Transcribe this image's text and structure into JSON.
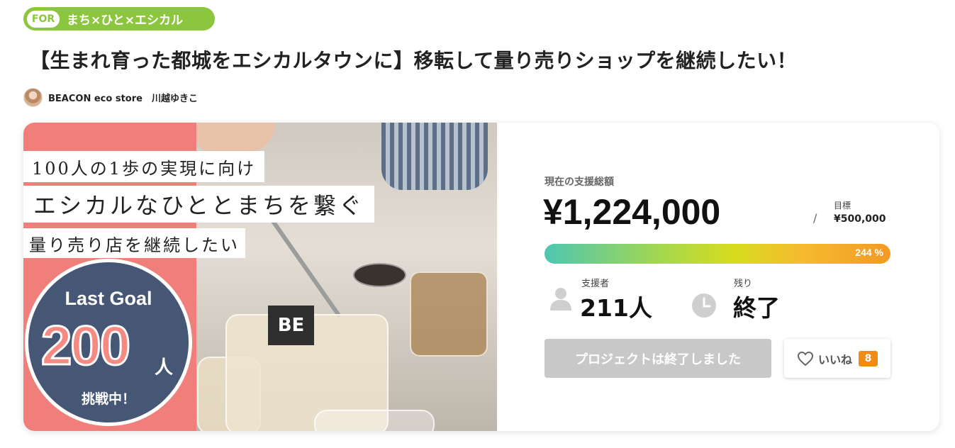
{
  "tag": {
    "prefix": "FOR",
    "label": "まち×ひと×エシカル"
  },
  "title": "【生まれ育った都城をエシカルタウンに】移転して量り売りショップを継続したい！",
  "owner": {
    "name": "BEACON eco store　川越ゆきこ"
  },
  "hero": {
    "caption1": "100人の1歩の実現に向け",
    "caption2": "エシカルなひととまちを繋ぐ",
    "caption3": "量り売り店を継続したい",
    "goal_title": "Last Goal",
    "goal_number": "200",
    "goal_unit": "人",
    "goal_sub": "挑戦中！",
    "jar_label": "BE"
  },
  "funding": {
    "amount_label": "現在の支援総額",
    "amount": "¥1,224,000",
    "slash": "/",
    "target_label": "目標",
    "target_value": "¥500,000",
    "progress_percent_label": "244 %",
    "progress_ratio": 2.44,
    "backers_label": "支援者",
    "backers_value": "211人",
    "remaining_label": "残り",
    "remaining_value": "終了"
  },
  "actions": {
    "ended_label": "プロジェクトは終了しました",
    "like_label": "いいね",
    "like_count": "8"
  },
  "icons": {
    "avatar": "avatar-icon",
    "person": "person-icon",
    "clock": "clock-icon",
    "heart": "heart-icon"
  },
  "colors": {
    "tag_green": "#8cc63e",
    "hero_pink": "#f07e7b",
    "goal_navy": "#465675",
    "accent_orange": "#f28a18",
    "ended_gray": "#c8c8c8"
  }
}
